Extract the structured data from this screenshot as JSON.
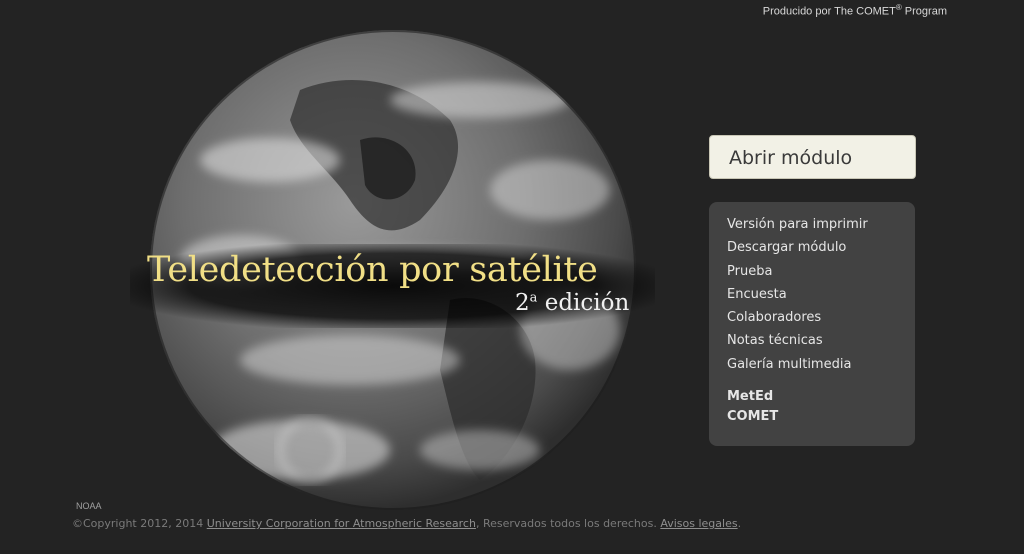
{
  "header": {
    "produced_by": "Producido por The COMET",
    "registered": "®",
    "program": " Program"
  },
  "hero": {
    "title": "Teledetección por satélite",
    "edition_number": "2",
    "edition_super": "a",
    "edition_word": " edición",
    "image": "earth-globe-grayscale"
  },
  "open_button": {
    "label": "Abrir módulo"
  },
  "menu": {
    "items": [
      "Versión para imprimir",
      "Descargar módulo",
      "Prueba",
      "Encuesta",
      "Colaboradores",
      "Notas técnicas",
      "Galería multimedia"
    ],
    "links": [
      "MetEd",
      "COMET"
    ]
  },
  "footer": {
    "credit": "NOAA",
    "copyright": "©Copyright 2012, 2014 ",
    "ucar_link": "University Corporation for Atmospheric Research",
    "rights": ", Reservados todos los derechos. ",
    "legal_link": "Avisos legales",
    "end": "."
  },
  "colors": {
    "background": "#232323",
    "title": "#f1df86",
    "menu_bg": "#424242",
    "button_bg": "#f2f1e6"
  }
}
